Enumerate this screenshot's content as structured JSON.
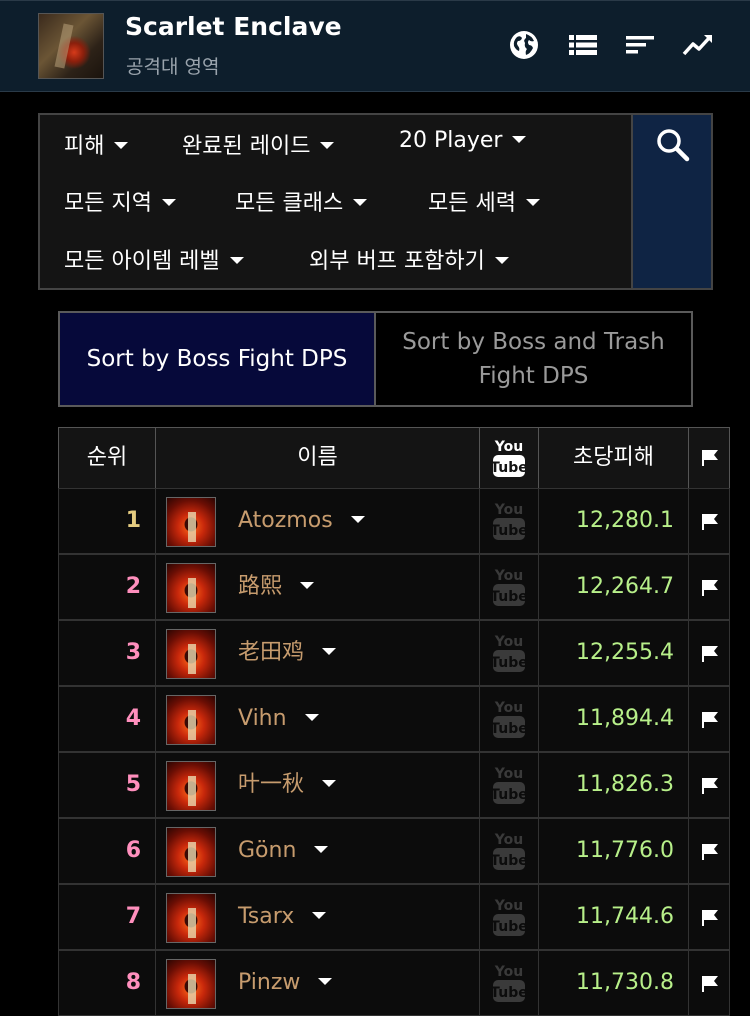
{
  "header": {
    "title": "Scarlet Enclave",
    "subtitle": "공격대 영역"
  },
  "filters": {
    "row1": [
      "피해",
      "완료된 레이드",
      "20 Player"
    ],
    "row2": [
      "모든 지역",
      "모든 클래스",
      "모든 세력"
    ],
    "row3": [
      "모든 아이템 레벨",
      "외부 버프 포함하기"
    ]
  },
  "sort": {
    "boss_label": "Sort by Boss Fight DPS",
    "trash_label_1": "Sort by Boss and Trash",
    "trash_label_2": "Fight DPS"
  },
  "table": {
    "headers": {
      "rank": "순위",
      "name": "이름",
      "youtube": "YouTube",
      "dps": "초당피해"
    },
    "rows": [
      {
        "rank": "1",
        "name": "Atozmos",
        "dps": "12,280.1"
      },
      {
        "rank": "2",
        "name": "路熙",
        "dps": "12,264.7"
      },
      {
        "rank": "3",
        "name": "老田鸡",
        "dps": "12,255.4"
      },
      {
        "rank": "4",
        "name": "Vihn",
        "dps": "11,894.4"
      },
      {
        "rank": "5",
        "name": "叶一秋",
        "dps": "11,826.3"
      },
      {
        "rank": "6",
        "name": "Gönn",
        "dps": "11,776.0"
      },
      {
        "rank": "7",
        "name": "Tsarx",
        "dps": "11,744.6"
      },
      {
        "rank": "8",
        "name": "Pinzw",
        "dps": "11,730.8"
      }
    ]
  },
  "colors": {
    "rank1": "#e5cc80",
    "rank_other": "#ff8fbd",
    "dps": "#b8f08a",
    "player_name": "#c79c6e",
    "header_bg": "#0d1e2c"
  }
}
